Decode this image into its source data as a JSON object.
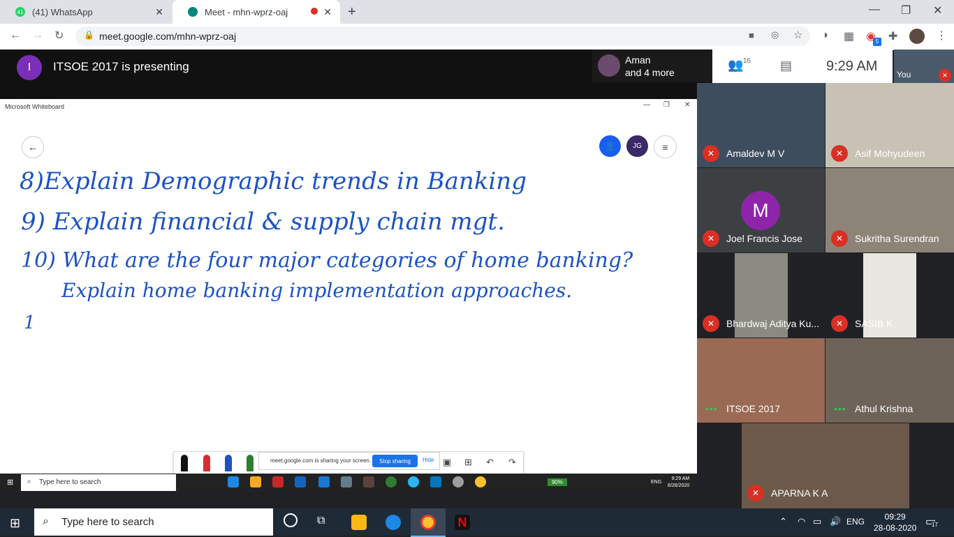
{
  "browser": {
    "tabs": [
      {
        "label": "(41) WhatsApp",
        "badge": "41"
      },
      {
        "label": "Meet - mhn-wprz-oaj"
      }
    ],
    "url": "meet.google.com/mhn-wprz-oaj",
    "extension_badge": "5"
  },
  "meet": {
    "presenter_initial": "I",
    "presenting_title": "ITSOE 2017 is presenting",
    "speaker": {
      "name": "Aman",
      "more": "and 4 more"
    },
    "people_count": "16",
    "time": "9:29  AM",
    "self_label": "You",
    "participants": [
      {
        "name": "Amaldev M V",
        "muted": true
      },
      {
        "name": "Asif Mohyudeen",
        "muted": true
      },
      {
        "name": "Joel Francis Jose",
        "muted": true,
        "initial": "M"
      },
      {
        "name": "Sukritha Surendran",
        "muted": true
      },
      {
        "name": "Bhardwaj Aditya Ku...",
        "muted": true
      },
      {
        "name": "SASIB K",
        "muted": true
      },
      {
        "name": "ITSOE 2017",
        "muted": false
      },
      {
        "name": "Athul Krishna",
        "muted": false
      },
      {
        "name": "APARNA K A",
        "muted": true
      }
    ]
  },
  "whiteboard": {
    "window_title": "Microsoft Whiteboard",
    "user_initials": "JG",
    "lines": [
      "8)Explain Demographic trends in Banking",
      "9) Explain financial & supply chain mgt.",
      "10) What are the four major categories of home banking?",
      "Explain home banking implementation approaches.",
      "1"
    ],
    "share_notice": "meet.google.com is sharing your screen.",
    "stop_sharing": "Stop sharing",
    "hide": "Hide",
    "inner_search": "Type here to search",
    "inner_battery": "90%",
    "inner_lang": "ENG",
    "inner_time": "9:29 AM",
    "inner_date": "8/28/2020"
  },
  "taskbar": {
    "search_placeholder": "Type here to search",
    "lang": "ENG",
    "time": "09:29",
    "date": "28-08-2020",
    "notification_count": "17"
  }
}
